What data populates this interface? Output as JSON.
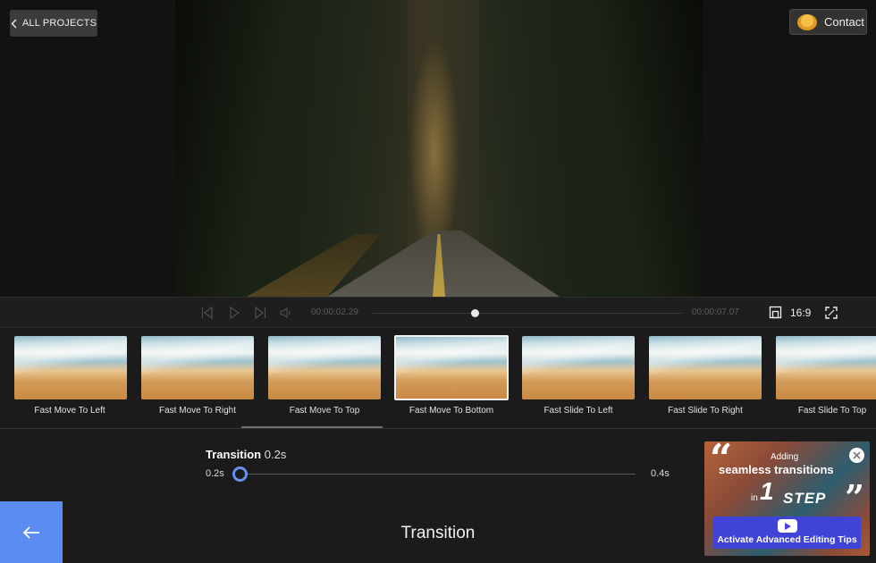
{
  "header": {
    "all_projects_label": "ALL PROJECTS",
    "contact_label": "Contact"
  },
  "playback": {
    "current_time": "00:00:02.29",
    "total_time": "00:00:07.07",
    "aspect_ratio": "16:9",
    "progress": 0.33
  },
  "transitions": {
    "items": [
      {
        "label": "Fast Move To Left"
      },
      {
        "label": "Fast Move To Right"
      },
      {
        "label": "Fast Move To Top"
      },
      {
        "label": "Fast Move To Bottom"
      },
      {
        "label": "Fast Slide To Left"
      },
      {
        "label": "Fast Slide To Right"
      },
      {
        "label": "Fast Slide To Top"
      }
    ],
    "selected_label": "Fast Move To Bottom"
  },
  "settings": {
    "title": "Transition",
    "value": "0.2s",
    "min_label": "0.2s",
    "max_label": "0.4s",
    "slider_level": 0
  },
  "footer": {
    "title": "Transition"
  },
  "promo": {
    "line1": "Adding",
    "line2": "seamless transitions",
    "line3": "in",
    "line4": "1",
    "line5": "STEP",
    "cta_label": "Activate Advanced Editing Tips"
  },
  "colors": {
    "accent": "#5b8cf2",
    "slider_knob": "#6b8ff0",
    "cta": "#3f43d6"
  }
}
